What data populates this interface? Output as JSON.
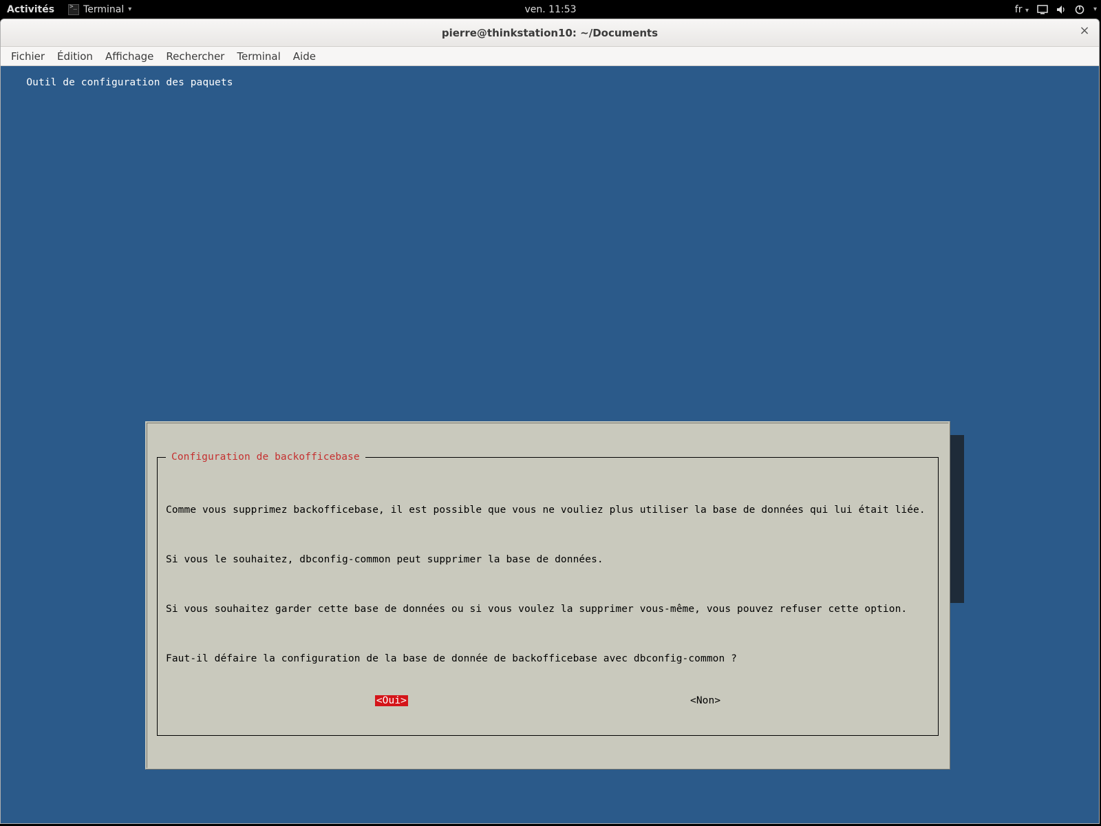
{
  "topbar": {
    "activities": "Activités",
    "app_name": "Terminal",
    "clock": "ven. 11:53",
    "lang": "fr"
  },
  "window": {
    "title": "pierre@thinkstation10: ~/Documents"
  },
  "menubar": {
    "file": "Fichier",
    "edit": "Édition",
    "view": "Affichage",
    "search": "Rechercher",
    "terminal": "Terminal",
    "help": "Aide"
  },
  "terminal": {
    "heading": "Outil de configuration des paquets"
  },
  "dialog": {
    "title": "Configuration de backofficebase",
    "p1": "Comme vous supprimez backofficebase, il est possible que vous ne vouliez plus utiliser la base de données qui lui était liée.",
    "p2": "Si vous le souhaitez, dbconfig-common peut supprimer la base de données.",
    "p3": "Si vous souhaitez garder cette base de données ou si vous voulez la supprimer vous-même, vous pouvez refuser cette option.",
    "p4": "Faut-il défaire la configuration de la base de donnée de backofficebase avec dbconfig-common ?",
    "yes": "<Oui>",
    "no": "<Non>"
  }
}
